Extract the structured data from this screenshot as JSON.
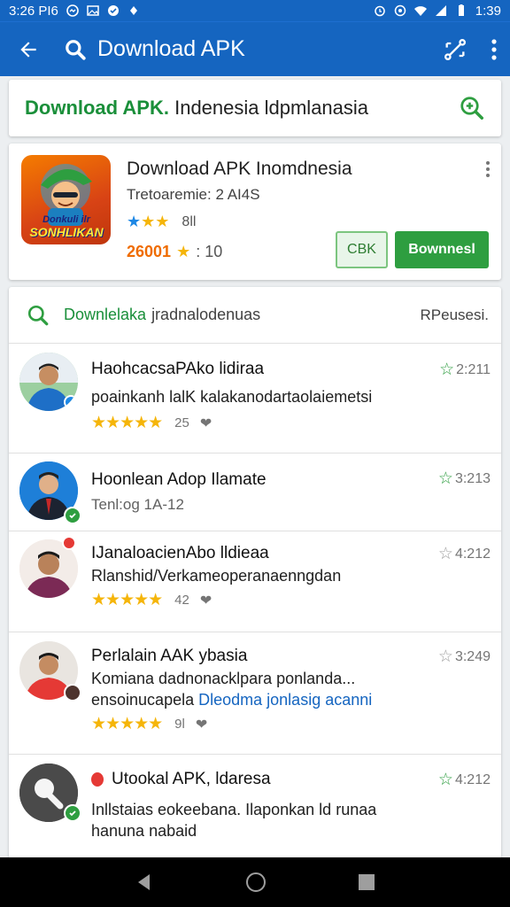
{
  "status_bar": {
    "time_left": "3:26 PI6",
    "time_right": "1:39"
  },
  "app_bar": {
    "title": "Download APK"
  },
  "search": {
    "query_highlight": "Download APK.",
    "query_rest": "Indenesia ldpmlanasia"
  },
  "app": {
    "name": "Download APK Inomdnesia",
    "subtitle": "Tretoaremie: 2 AI4S",
    "rating_count": "8ll",
    "downloads": "26001",
    "downloads_extra": ": 10",
    "icon_text_1": "Donkuli ilr",
    "icon_text_2": "SONHLIKAN",
    "button_secondary": "CBK",
    "button_primary": "Bownnesl"
  },
  "list": {
    "header_label": "Downlelaka",
    "header_label_rest": "jradnalodenuas",
    "sort_label": "RPeusesi."
  },
  "reviews": [
    {
      "name": "HaohcacsaPAko lidiraa",
      "text": "poainkanh lalK kalakanodartaolaiemetsi",
      "stars": "★★★★★",
      "count": "25",
      "score": "2:211"
    },
    {
      "name": "Hoonlean Adop Ilamate",
      "text": "Tenl:og 1A-12",
      "stars": "",
      "count": "",
      "score": "3:213"
    },
    {
      "name": "IJanaloacienAbo lldieaa",
      "text": "Rlanshid/Verkameoperanaenngdan",
      "stars": "★★★★★",
      "count": "42",
      "score": "4:212"
    },
    {
      "name": "Perlalain AAK ybasia",
      "text": "Komiana dadnonacklpara ponlanda...",
      "text2": "ensoinucapela",
      "link": "Dleodma jonlasig acanni",
      "stars": "★★★★★",
      "count": "9l",
      "score": "3:249"
    },
    {
      "name": "Utookal APK, ldaresa",
      "text": "Inllstaias eokeebana. Ilaponkan ld runaa",
      "text2": "hanuna nabaid",
      "stars": "",
      "count": "",
      "score": "4:212"
    }
  ],
  "colors": {
    "primary": "#1565c0",
    "accent_green": "#2e9e40",
    "star": "#f5b50a",
    "download_orange": "#ef6c00"
  }
}
